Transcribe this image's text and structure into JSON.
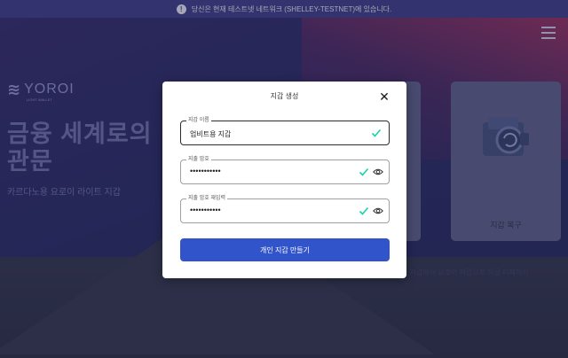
{
  "banner": {
    "info_icon": "info-circle-icon",
    "text": "당신은 현재 테스트넷 네트워크 (SHELLEY-TESTNET)에 있습니다."
  },
  "brand": {
    "name": "YOROI",
    "tagline": "LIGHT WALLET"
  },
  "hero": {
    "title_line1": "금융 세계로의",
    "title_line2": "관문",
    "subtitle": "카르다노용 요로이 라이트 지갑"
  },
  "cards": {
    "restore_label": "지갑 복구",
    "hint": "스 지갑에서 요로이 지갑으로 자금 이체하기"
  },
  "modal": {
    "title": "지갑 생성",
    "close_icon": "close-icon",
    "wallet_name": {
      "label": "지갑 이름",
      "value": "업비트용 지갑"
    },
    "spending_password": {
      "label": "지출 암호",
      "value": "•••••••••••"
    },
    "repeat_password": {
      "label": "지출 암호 재입력",
      "value": "•••••••••••"
    },
    "submit_label": "개인 지갑 만들기"
  },
  "colors": {
    "primary": "#3154cb",
    "check": "#17d1aa",
    "banner": "#3a3a86"
  }
}
